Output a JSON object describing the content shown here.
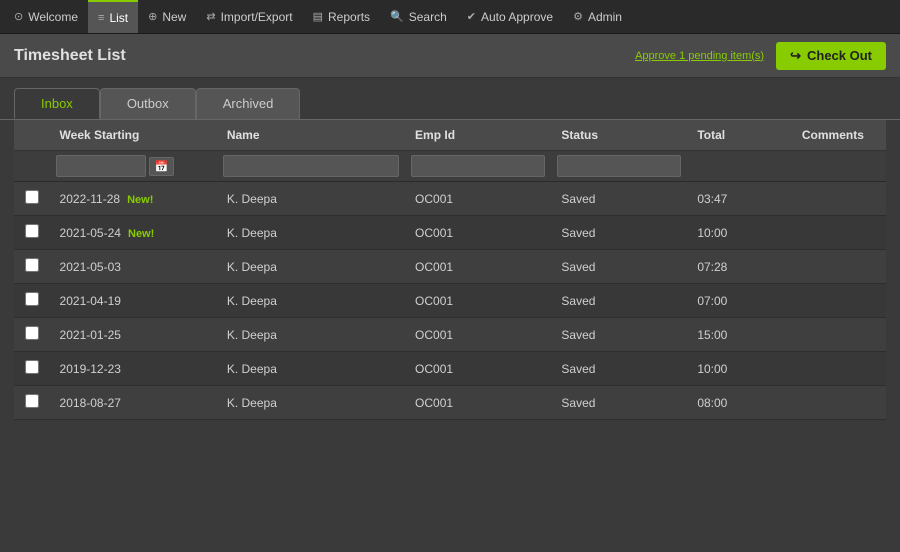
{
  "nav": {
    "items": [
      {
        "id": "welcome",
        "label": "Welcome",
        "icon": "⊙",
        "active": false
      },
      {
        "id": "list",
        "label": "List",
        "icon": "≡",
        "active": true
      },
      {
        "id": "new",
        "label": "New",
        "icon": "⊕",
        "active": false
      },
      {
        "id": "import-export",
        "label": "Import/Export",
        "icon": "⇄",
        "active": false
      },
      {
        "id": "reports",
        "label": "Reports",
        "icon": "📋",
        "active": false
      },
      {
        "id": "search",
        "label": "Search",
        "icon": "🔍",
        "active": false
      },
      {
        "id": "auto-approve",
        "label": "Auto Approve",
        "icon": "✔",
        "active": false
      },
      {
        "id": "admin",
        "label": "Admin",
        "icon": "⚙",
        "active": false
      }
    ]
  },
  "header": {
    "title": "Timesheet List",
    "approve_link": "Approve 1 pending item(s)",
    "checkout_label": "Check Out"
  },
  "tabs": [
    {
      "id": "inbox",
      "label": "Inbox",
      "active": true
    },
    {
      "id": "outbox",
      "label": "Outbox",
      "active": false
    },
    {
      "id": "archived",
      "label": "Archived",
      "active": false
    }
  ],
  "table": {
    "columns": [
      {
        "id": "select",
        "label": ""
      },
      {
        "id": "week_starting",
        "label": "Week Starting"
      },
      {
        "id": "name",
        "label": "Name"
      },
      {
        "id": "emp_id",
        "label": "Emp Id"
      },
      {
        "id": "status",
        "label": "Status"
      },
      {
        "id": "total",
        "label": "Total"
      },
      {
        "id": "comments",
        "label": "Comments"
      }
    ],
    "rows": [
      {
        "id": 1,
        "week_starting": "2022-11-28",
        "is_new": true,
        "name": "K. Deepa",
        "emp_id": "OC001",
        "status": "Saved",
        "total": "03:47",
        "comments": ""
      },
      {
        "id": 2,
        "week_starting": "2021-05-24",
        "is_new": true,
        "name": "K. Deepa",
        "emp_id": "OC001",
        "status": "Saved",
        "total": "10:00",
        "comments": ""
      },
      {
        "id": 3,
        "week_starting": "2021-05-03",
        "is_new": false,
        "name": "K. Deepa",
        "emp_id": "OC001",
        "status": "Saved",
        "total": "07:28",
        "comments": ""
      },
      {
        "id": 4,
        "week_starting": "2021-04-19",
        "is_new": false,
        "name": "K. Deepa",
        "emp_id": "OC001",
        "status": "Saved",
        "total": "07:00",
        "comments": ""
      },
      {
        "id": 5,
        "week_starting": "2021-01-25",
        "is_new": false,
        "name": "K. Deepa",
        "emp_id": "OC001",
        "status": "Saved",
        "total": "15:00",
        "comments": ""
      },
      {
        "id": 6,
        "week_starting": "2019-12-23",
        "is_new": false,
        "name": "K. Deepa",
        "emp_id": "OC001",
        "status": "Saved",
        "total": "10:00",
        "comments": ""
      },
      {
        "id": 7,
        "week_starting": "2018-08-27",
        "is_new": false,
        "name": "K. Deepa",
        "emp_id": "OC001",
        "status": "Saved",
        "total": "08:00",
        "comments": ""
      }
    ],
    "new_label": "New!"
  }
}
